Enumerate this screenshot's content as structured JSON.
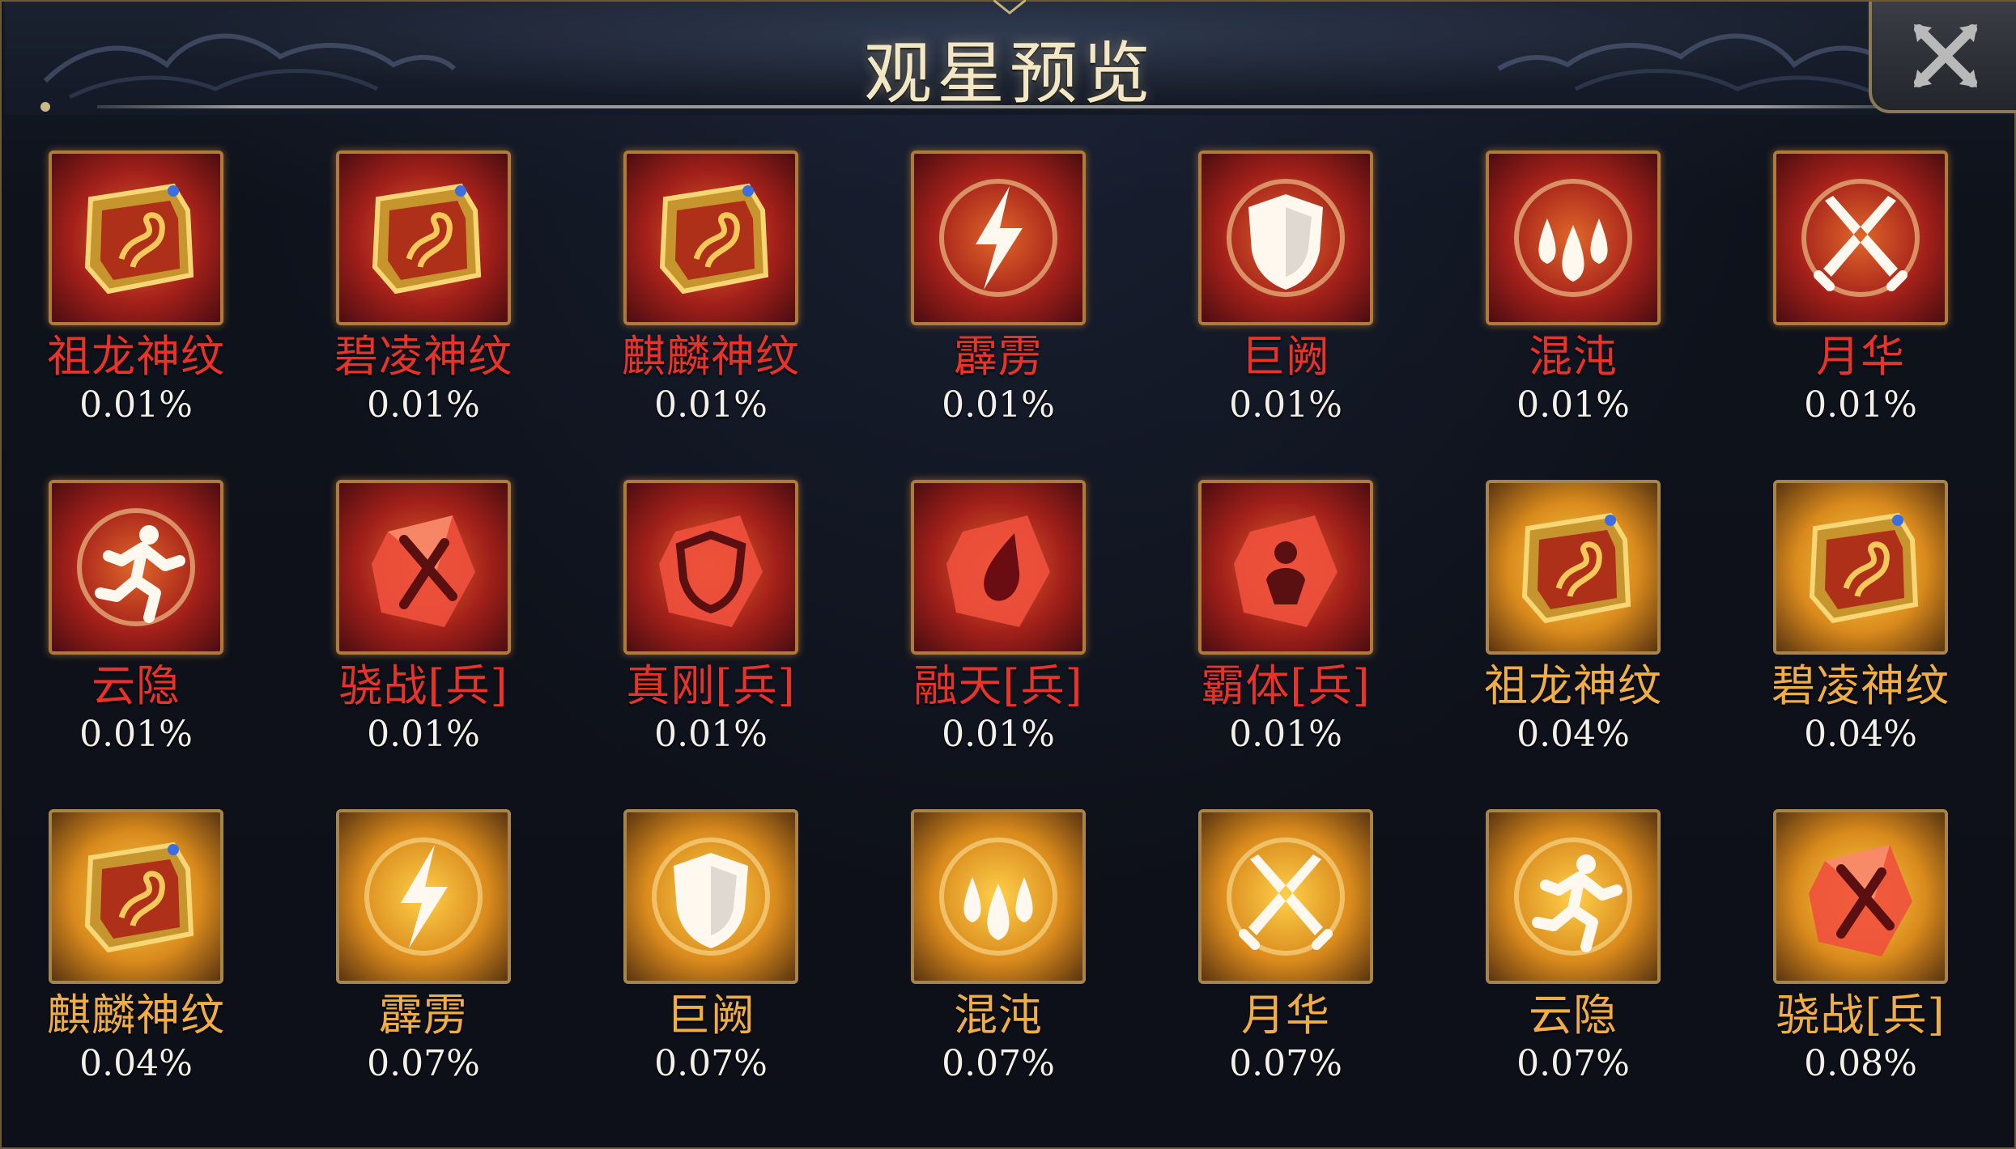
{
  "header": {
    "title": "观星预览"
  },
  "close_icon": "close-x-icon",
  "colors": {
    "rare_name": "#e8322a",
    "common_name": "#f0ad46",
    "percent": "#f4f1ea"
  },
  "items": [
    {
      "name": "祖龙神纹",
      "pct": "0.01%",
      "tier": "red",
      "icon": "dragon-rune-icon"
    },
    {
      "name": "碧凌神纹",
      "pct": "0.01%",
      "tier": "red",
      "icon": "beast-rune-icon"
    },
    {
      "name": "麒麟神纹",
      "pct": "0.01%",
      "tier": "red",
      "icon": "qilin-rune-icon"
    },
    {
      "name": "霹雳",
      "pct": "0.01%",
      "tier": "red",
      "icon": "lightning-icon"
    },
    {
      "name": "巨阙",
      "pct": "0.01%",
      "tier": "red",
      "icon": "shield-icon"
    },
    {
      "name": "混沌",
      "pct": "0.01%",
      "tier": "red",
      "icon": "droplets-icon"
    },
    {
      "name": "月华",
      "pct": "0.01%",
      "tier": "red",
      "icon": "crossed-swords-icon"
    },
    {
      "name": "云隐",
      "pct": "0.01%",
      "tier": "red",
      "icon": "runner-icon"
    },
    {
      "name": "骁战[兵]",
      "pct": "0.01%",
      "tier": "red",
      "icon": "sword-crystal-icon"
    },
    {
      "name": "真刚[兵]",
      "pct": "0.01%",
      "tier": "red",
      "icon": "shield-crystal-icon"
    },
    {
      "name": "融天[兵]",
      "pct": "0.01%",
      "tier": "red",
      "icon": "drop-crystal-icon"
    },
    {
      "name": "霸体[兵]",
      "pct": "0.01%",
      "tier": "red",
      "icon": "body-crystal-icon"
    },
    {
      "name": "祖龙神纹",
      "pct": "0.04%",
      "tier": "gold",
      "icon": "dragon-rune-icon"
    },
    {
      "name": "碧凌神纹",
      "pct": "0.04%",
      "tier": "gold",
      "icon": "beast-rune-icon"
    },
    {
      "name": "麒麟神纹",
      "pct": "0.04%",
      "tier": "gold",
      "icon": "qilin-rune-icon"
    },
    {
      "name": "霹雳",
      "pct": "0.07%",
      "tier": "gold",
      "icon": "lightning-icon"
    },
    {
      "name": "巨阙",
      "pct": "0.07%",
      "tier": "gold",
      "icon": "shield-icon"
    },
    {
      "name": "混沌",
      "pct": "0.07%",
      "tier": "gold",
      "icon": "droplets-icon"
    },
    {
      "name": "月华",
      "pct": "0.07%",
      "tier": "gold",
      "icon": "crossed-swords-icon"
    },
    {
      "name": "云隐",
      "pct": "0.07%",
      "tier": "gold",
      "icon": "runner-icon"
    },
    {
      "name": "骁战[兵]",
      "pct": "0.08%",
      "tier": "gold",
      "icon": "sword-crystal-icon"
    }
  ]
}
